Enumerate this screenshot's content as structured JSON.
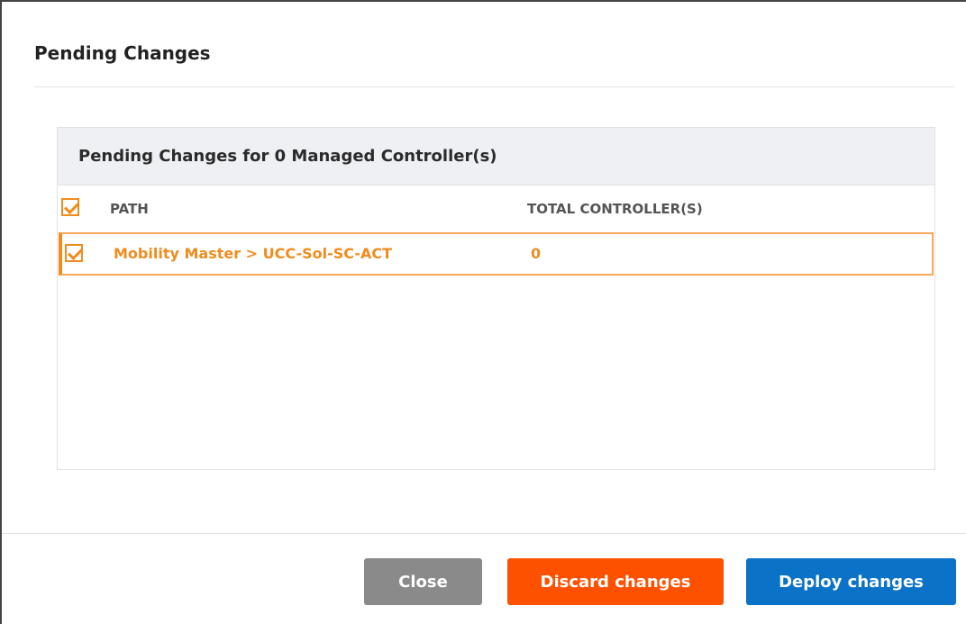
{
  "dialog": {
    "title": "Pending Changes"
  },
  "panel": {
    "header": "Pending Changes for 0 Managed Controller(s)",
    "columns": {
      "path": "PATH",
      "total": "TOTAL CONTROLLER(S)"
    },
    "rows": [
      {
        "path": "Mobility Master > UCC-Sol-SC-ACT",
        "total": "0",
        "checked": true
      }
    ],
    "select_all_checked": true
  },
  "footer": {
    "close_label": "Close",
    "discard_label": "Discard changes",
    "deploy_label": "Deploy changes"
  },
  "colors": {
    "accent_orange": "#f08c1e",
    "discard": "#fd5100",
    "deploy": "#0b73c7",
    "close": "#8a8a8a"
  }
}
